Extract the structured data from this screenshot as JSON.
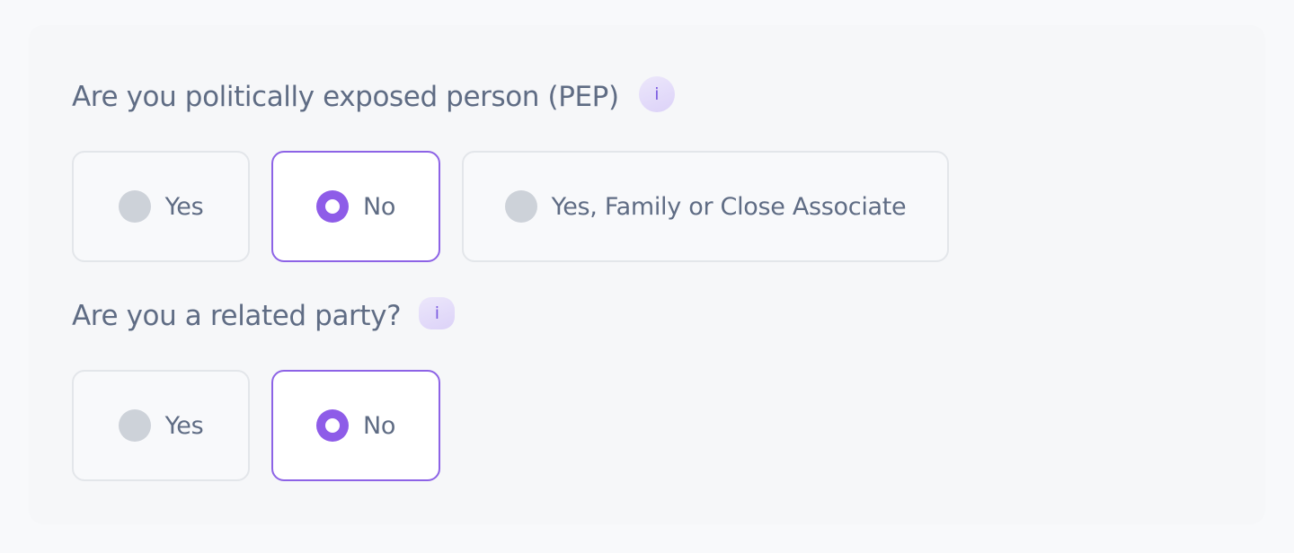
{
  "questions": [
    {
      "text": "Are you politically exposed person (PEP)",
      "info_icon": "info-icon",
      "options": [
        {
          "label": "Yes",
          "selected": false
        },
        {
          "label": "No",
          "selected": true
        },
        {
          "label": "Yes, Family or Close Associate",
          "selected": false
        }
      ]
    },
    {
      "text": "Are you a related party?",
      "info_icon": "info-icon",
      "options": [
        {
          "label": "Yes",
          "selected": false
        },
        {
          "label": "No",
          "selected": true
        }
      ]
    }
  ],
  "info_glyph": "i",
  "colors": {
    "accent": "#8e5ce8",
    "text": "#5f6c84",
    "radio_unselected": "#cdd2d9",
    "border": "#e3e6ea"
  }
}
